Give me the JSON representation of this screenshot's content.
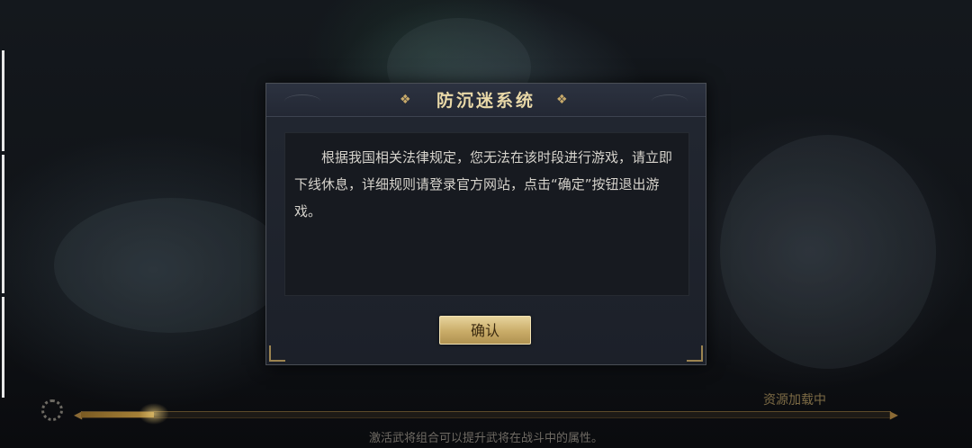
{
  "dialog": {
    "title": "防沉迷系统",
    "message": "根据我国相关法律规定，您无法在该时段进行游戏，请立即下线休息，详细规则请登录官方网站，点击“确定”按钮退出游戏。",
    "confirm_label": "确认"
  },
  "loading": {
    "status": "资源加载中",
    "progress": 0.09,
    "tip": "激活武将组合可以提升武将在战斗中的属性。"
  },
  "colors": {
    "title_gold": "#e9d9a8",
    "button_gold": "#c9ac68",
    "dialog_bg": "#1c2029"
  }
}
